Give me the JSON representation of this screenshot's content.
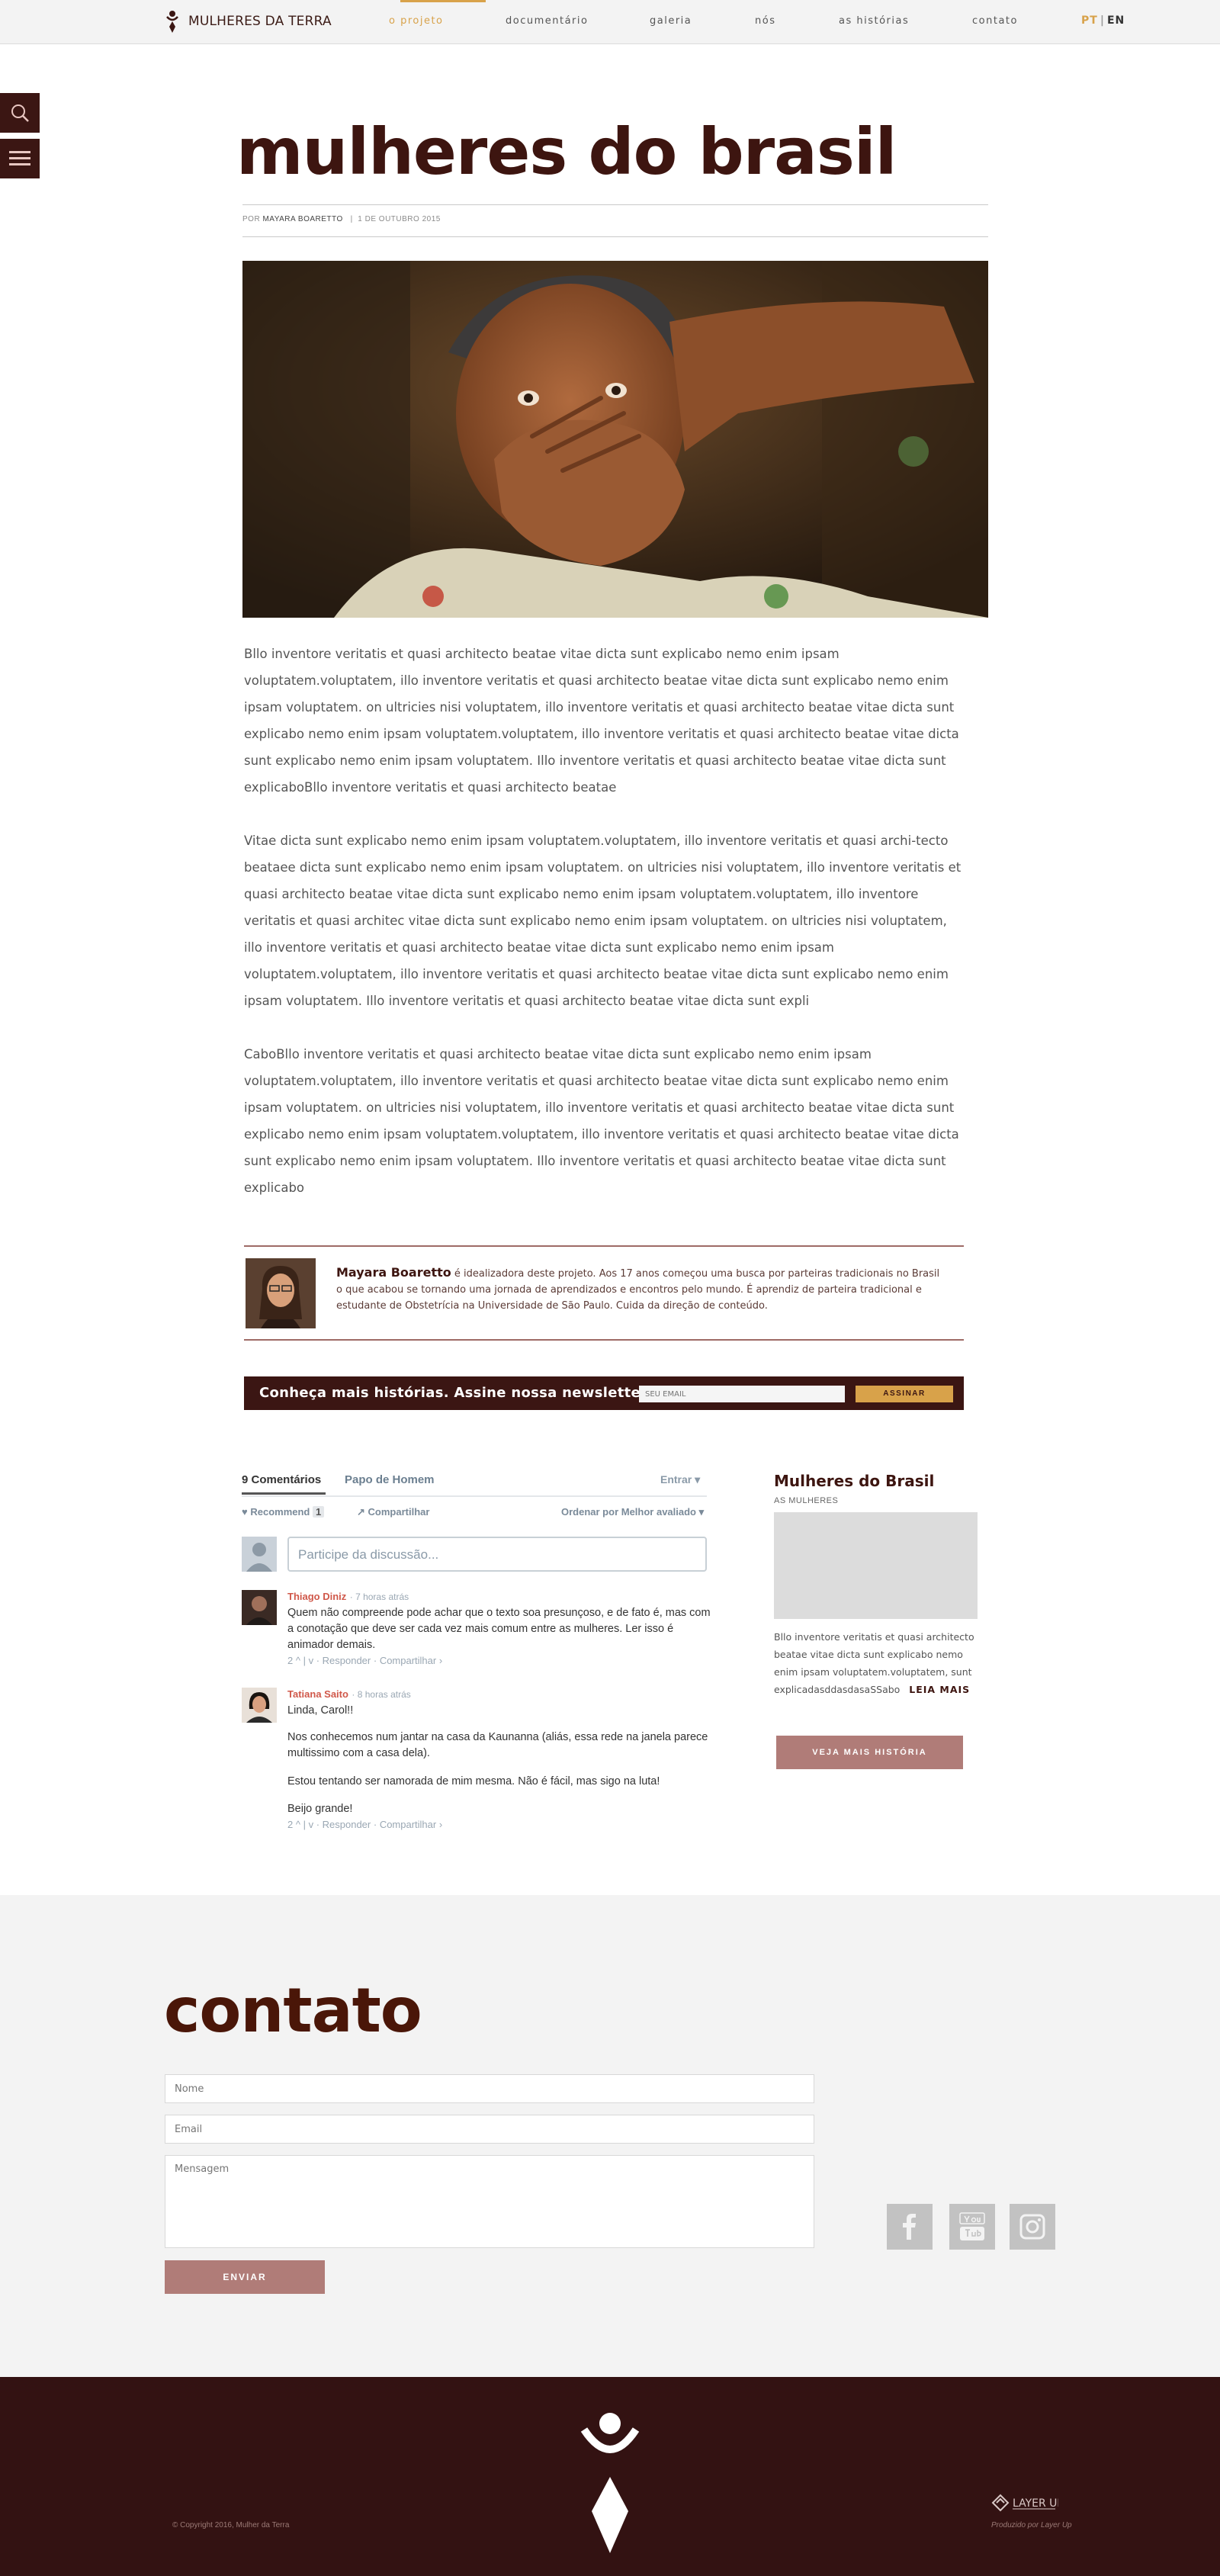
{
  "nav": {
    "brand": "MULHERES DA TERRA",
    "items": [
      "o projeto",
      "documentário",
      "galeria",
      "nós",
      "as histórias",
      "contato"
    ],
    "active": 0,
    "lang_pt": "PT",
    "lang_sep": "|",
    "lang_en": "EN"
  },
  "article": {
    "title": "mulheres do brasil",
    "by_label": "POR",
    "author": "MAYARA BOARETTO",
    "meta_sep": "|",
    "date": "1 DE OUTUBRO 2015",
    "paragraphs": [
      "Bllo inventore veritatis et quasi architecto beatae vitae dicta sunt explicabo nemo enim ipsam voluptatem.voluptatem, illo inventore veritatis et quasi architecto beatae vitae dicta sunt explicabo nemo enim ipsam voluptatem. on ultricies nisi voluptatem, illo inventore veritatis et quasi architecto beatae vitae dicta sunt explicabo nemo enim ipsam voluptatem.voluptatem, illo inventore veritatis et quasi architecto beatae vitae dicta sunt explicabo nemo enim ipsam voluptatem. Illo inventore veritatis et quasi architecto beatae vitae dicta sunt explicaboBllo inventore veritatis et quasi architecto beatae",
      "Vitae dicta sunt explicabo nemo enim ipsam voluptatem.voluptatem, illo inventore veritatis et quasi archi-tecto beataee dicta sunt explicabo nemo enim ipsam voluptatem. on ultricies nisi voluptatem, illo inventore veritatis et quasi architecto beatae vitae dicta sunt explicabo nemo enim ipsam voluptatem.voluptatem, illo inventore veritatis et quasi architec vitae dicta sunt explicabo nemo enim ipsam voluptatem. on ultricies nisi voluptatem, illo inventore veritatis et quasi architecto beatae vitae dicta sunt explicabo nemo enim ipsam voluptatem.voluptatem, illo inventore veritatis et quasi architecto beatae vitae dicta sunt explicabo nemo enim ipsam voluptatem. Illo inventore veritatis et quasi architecto beatae vitae dicta sunt expli",
      "CaboBllo inventore veritatis et quasi architecto beatae vitae dicta sunt explicabo nemo enim ipsam voluptatem.voluptatem, illo inventore veritatis et quasi architecto beatae vitae dicta sunt explicabo nemo enim ipsam voluptatem. on ultricies nisi voluptatem, illo inventore veritatis et quasi architecto beatae vitae dicta sunt explicabo nemo enim ipsam voluptatem.voluptatem, illo inventore veritatis et quasi architecto beatae vitae dicta sunt explicabo nemo enim ipsam voluptatem. Illo inventore veritatis et quasi architecto beatae vitae dicta sunt explicabo"
    ]
  },
  "author_box": {
    "name": "Mayara Boaretto",
    "bio": " é idealizadora deste projeto. Aos 17 anos começou uma busca por parteiras tradicionais no Brasil o que acabou se tornando uma jornada de aprendizados e encontros pelo mundo. É aprendiz de parteira tradicional e estudante de Obstetrícia na Universidade de São Paulo. Cuida da direção de conteúdo."
  },
  "newsletter": {
    "text": "Conheça mais histórias. Assine nossa newsletter.",
    "email_placeholder": "SEU EMAIL",
    "button": "ASSINAR"
  },
  "comments": {
    "tab_active": "9 Comentários",
    "tab_other": "Papo de Homem",
    "login": "Entrar",
    "recommend": "Recommend",
    "recommend_count": "1",
    "share": "Compartilhar",
    "sort": "Ordenar por Melhor avaliado",
    "input_placeholder": "Participe da discussão...",
    "items": [
      {
        "name": "Thiago Diniz",
        "time": "7 horas atrás",
        "lines": [
          "Quem não compreende pode achar que o texto soa presunçoso, e de fato é, mas com a conotação que deve ser cada vez mais comum entre as mulheres. Ler isso é animador demais."
        ],
        "votes": "2",
        "reply": "Responder",
        "share": "Compartilhar"
      },
      {
        "name": "Tatiana Saito",
        "time": "8 horas atrás",
        "lines": [
          "Linda, Carol!!",
          "Nos conhecemos num jantar na casa da Kaunanna (aliás, essa rede na janela parece multissimo com a casa dela).",
          "Estou tentando ser namorada de mim mesma. Não é fácil, mas sigo na luta!",
          "Beijo grande!"
        ],
        "votes": "2",
        "reply": "Responder",
        "share": "Compartilhar"
      }
    ]
  },
  "sidebar": {
    "title": "Mulheres do Brasil",
    "subtitle": "AS MULHERES",
    "text": "Bllo inventore veritatis et quasi architecto beatae vitae dicta sunt explicabo nemo enim ipsam voluptatem.voluptatem, sunt explicadasddasdasaSSabo",
    "more": "LEIA MAIS",
    "button": "VEJA MAIS HISTÓRIA"
  },
  "contact": {
    "title": "contato",
    "name_placeholder": "Nome",
    "email_placeholder": "Email",
    "message_placeholder": "Mensagem",
    "send": "ENVIAR"
  },
  "footer": {
    "copyright": "© Copyright 2016, Mulher da Terra",
    "layerup": "LAYER UP",
    "produced": "Produzido por Layer Up"
  },
  "colors": {
    "brand_dark": "#3b1613",
    "accent_gold": "#d8a24a",
    "rose": "#b07c78"
  },
  "icons": [
    "search-icon",
    "menu-icon",
    "facebook-icon",
    "youtube-icon",
    "instagram-icon",
    "brand-logo-icon"
  ]
}
